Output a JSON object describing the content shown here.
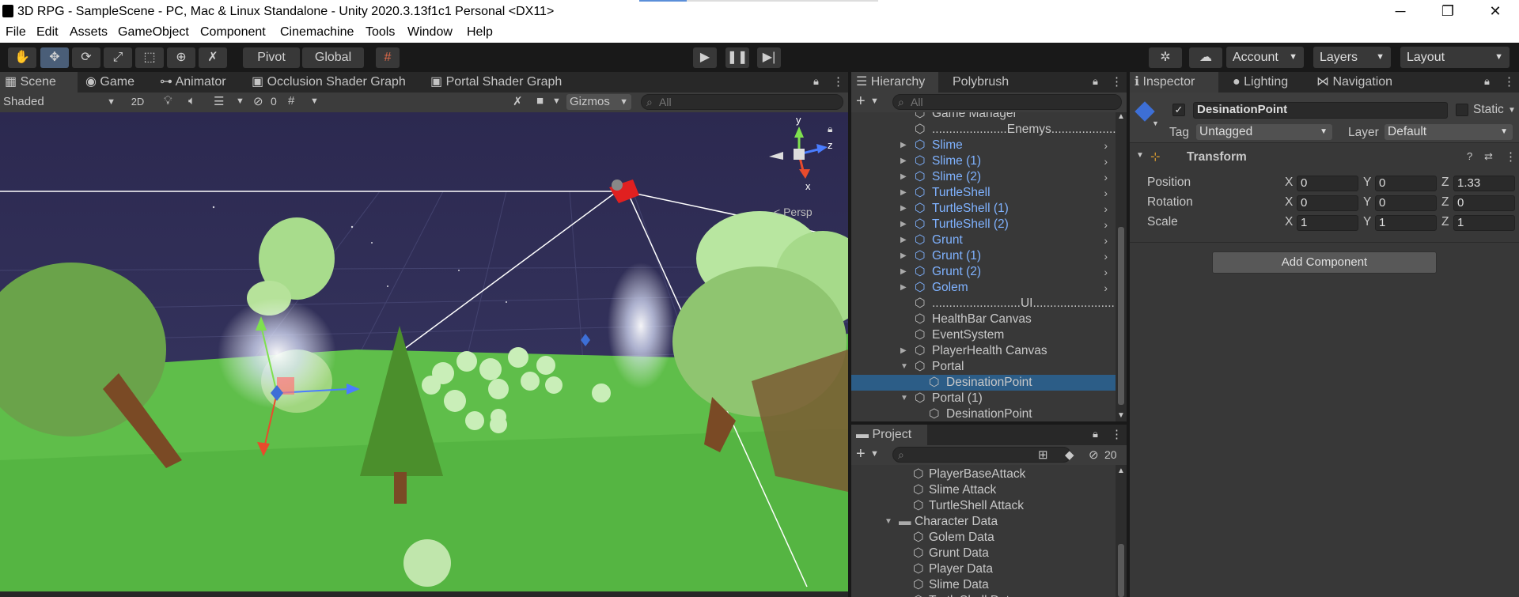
{
  "window": {
    "title": "3D RPG - SampleScene - PC, Mac & Linux Standalone - Unity 2020.3.13f1c1 Personal <DX11>",
    "minimize": "─",
    "maximize": "❐",
    "close": "✕"
  },
  "menu": [
    "File",
    "Edit",
    "Assets",
    "GameObject",
    "Component",
    "Cinemachine",
    "Tools",
    "Window",
    "Help"
  ],
  "toolbar": {
    "pivot": "Pivot",
    "global": "Global",
    "account": "Account",
    "layers": "Layers",
    "layout": "Layout"
  },
  "scene_tabs": [
    "Scene",
    "Game",
    "Animator",
    "Occlusion Shader Graph",
    "Portal Shader Graph"
  ],
  "scene_toolbar": {
    "shading": "Shaded",
    "mode2d": "2D",
    "hidden_count": "0",
    "gizmos": "Gizmos",
    "search_placeholder": "All"
  },
  "scene_view": {
    "gizmo_axes": [
      "y",
      "z",
      "x"
    ],
    "persp_label": "< Persp"
  },
  "hierarchy": {
    "tabs": [
      "Hierarchy",
      "Polybrush"
    ],
    "search_placeholder": "All",
    "items": [
      {
        "label": "Game Manager",
        "blue": false,
        "expand": "",
        "prefab": false,
        "indent": 0,
        "selected": false
      },
      {
        "label": "......................Enemys......................",
        "blue": false,
        "expand": "",
        "prefab": false,
        "indent": 0,
        "selected": false
      },
      {
        "label": "Slime",
        "blue": true,
        "expand": "right",
        "prefab": true,
        "indent": 0,
        "selected": false
      },
      {
        "label": "Slime (1)",
        "blue": true,
        "expand": "right",
        "prefab": true,
        "indent": 0,
        "selected": false
      },
      {
        "label": "Slime (2)",
        "blue": true,
        "expand": "right",
        "prefab": true,
        "indent": 0,
        "selected": false
      },
      {
        "label": "TurtleShell",
        "blue": true,
        "expand": "right",
        "prefab": true,
        "indent": 0,
        "selected": false
      },
      {
        "label": "TurtleShell (1)",
        "blue": true,
        "expand": "right",
        "prefab": true,
        "indent": 0,
        "selected": false
      },
      {
        "label": "TurtleShell (2)",
        "blue": true,
        "expand": "right",
        "prefab": true,
        "indent": 0,
        "selected": false
      },
      {
        "label": "Grunt",
        "blue": true,
        "expand": "right",
        "prefab": true,
        "indent": 0,
        "selected": false
      },
      {
        "label": "Grunt (1)",
        "blue": true,
        "expand": "right",
        "prefab": true,
        "indent": 0,
        "selected": false
      },
      {
        "label": "Grunt (2)",
        "blue": true,
        "expand": "right",
        "prefab": true,
        "indent": 0,
        "selected": false
      },
      {
        "label": "Golem",
        "blue": true,
        "expand": "right",
        "prefab": true,
        "indent": 0,
        "selected": false
      },
      {
        "label": "..........................UI..........................",
        "blue": false,
        "expand": "",
        "prefab": false,
        "indent": 0,
        "selected": false
      },
      {
        "label": "HealthBar Canvas",
        "blue": false,
        "expand": "",
        "prefab": false,
        "indent": 0,
        "selected": false
      },
      {
        "label": "EventSystem",
        "blue": false,
        "expand": "",
        "prefab": false,
        "indent": 0,
        "selected": false
      },
      {
        "label": "PlayerHealth Canvas",
        "blue": false,
        "expand": "right",
        "prefab": false,
        "indent": 0,
        "selected": false
      },
      {
        "label": "Portal",
        "blue": false,
        "expand": "down",
        "prefab": false,
        "indent": 0,
        "selected": false
      },
      {
        "label": "DesinationPoint",
        "blue": false,
        "expand": "",
        "prefab": false,
        "indent": 1,
        "selected": true
      },
      {
        "label": "Portal  (1)",
        "blue": false,
        "expand": "down",
        "prefab": false,
        "indent": 0,
        "selected": false
      },
      {
        "label": "DesinationPoint",
        "blue": false,
        "expand": "",
        "prefab": false,
        "indent": 1,
        "selected": false
      }
    ]
  },
  "project": {
    "tab": "Project",
    "hidden_count": "20",
    "items": [
      {
        "label": "PlayerBaseAttack",
        "folder": false,
        "expand": "",
        "indent": 1
      },
      {
        "label": "Slime Attack",
        "folder": false,
        "expand": "",
        "indent": 1
      },
      {
        "label": "TurtleShell Attack",
        "folder": false,
        "expand": "",
        "indent": 1
      },
      {
        "label": "Character Data",
        "folder": true,
        "expand": "down",
        "indent": 0
      },
      {
        "label": "Golem Data",
        "folder": false,
        "expand": "",
        "indent": 1
      },
      {
        "label": "Grunt Data",
        "folder": false,
        "expand": "",
        "indent": 1
      },
      {
        "label": "Player Data",
        "folder": false,
        "expand": "",
        "indent": 1
      },
      {
        "label": "Slime Data",
        "folder": false,
        "expand": "",
        "indent": 1
      },
      {
        "label": "TurtleShell Data",
        "folder": false,
        "expand": "",
        "indent": 1
      }
    ]
  },
  "inspector": {
    "tabs": [
      "Inspector",
      "Lighting",
      "Navigation"
    ],
    "object_name": "DesinationPoint",
    "active": true,
    "static_label": "Static",
    "tag_label": "Tag",
    "tag_value": "Untagged",
    "layer_label": "Layer",
    "layer_value": "Default",
    "component": "Transform",
    "rows": [
      {
        "label": "Position",
        "x": "0",
        "y": "0",
        "z": "1.33"
      },
      {
        "label": "Rotation",
        "x": "0",
        "y": "0",
        "z": "0"
      },
      {
        "label": "Scale",
        "x": "1",
        "y": "1",
        "z": "1"
      }
    ],
    "axis_x": "X",
    "axis_y": "Y",
    "axis_z": "Z",
    "add_component": "Add Component"
  },
  "colors": {
    "editor_bg": "#383838",
    "selection": "#2c5d87",
    "prefab_text": "#7fb2ff",
    "sky": "#2e2d54",
    "grass": "#5fc34a"
  }
}
